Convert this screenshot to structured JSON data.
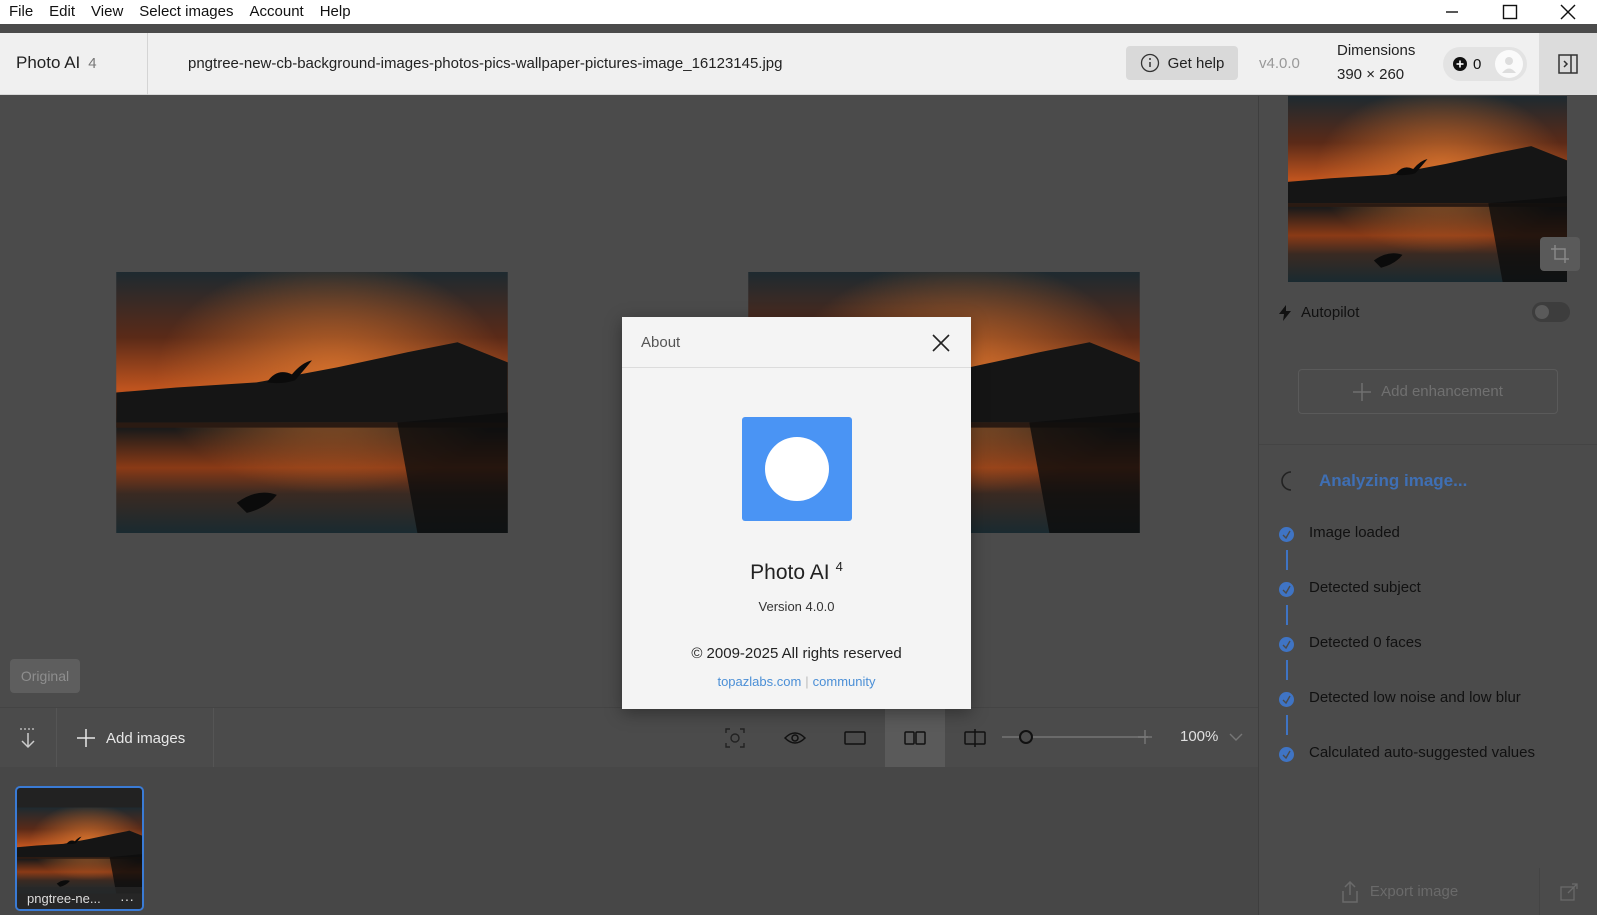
{
  "menu": [
    "File",
    "Edit",
    "View",
    "Select images",
    "Account",
    "Help"
  ],
  "header": {
    "app_name": "Photo AI",
    "app_major": "4",
    "filename": "pngtree-new-cb-background-images-photos-pics-wallpaper-pictures-image_16123145.jpg",
    "get_help": "Get help",
    "version": "v4.0.0",
    "dimensions_label": "Dimensions",
    "dimensions_value": "390 × 260",
    "credits": "0"
  },
  "canvas": {
    "original_badge": "Original"
  },
  "toolbar": {
    "add_images": "Add images",
    "zoom": "100%",
    "zoom_level_fraction": 0.1
  },
  "filmstrip": {
    "items": [
      {
        "label": "pngtree-ne...",
        "more": "···"
      }
    ]
  },
  "right_panel": {
    "autopilot": "Autopilot",
    "add_enhancement": "Add enhancement",
    "analyzing": "Analyzing image...",
    "steps": [
      "Image loaded",
      "Detected subject",
      "Detected 0 faces",
      "Detected low noise and low blur",
      "Calculated auto-suggested values"
    ],
    "export": "Export image"
  },
  "dialog": {
    "title": "About",
    "app_name": "Photo AI",
    "app_major": "4",
    "version": "Version 4.0.0",
    "copyright": "© 2009-2025 All rights reserved",
    "link1": "topazlabs.com",
    "link_sep": "|",
    "link2": "community"
  },
  "colors": {
    "accent": "#3f74c4",
    "logo_blue": "#4a94f4",
    "link": "#4b8fd6"
  }
}
